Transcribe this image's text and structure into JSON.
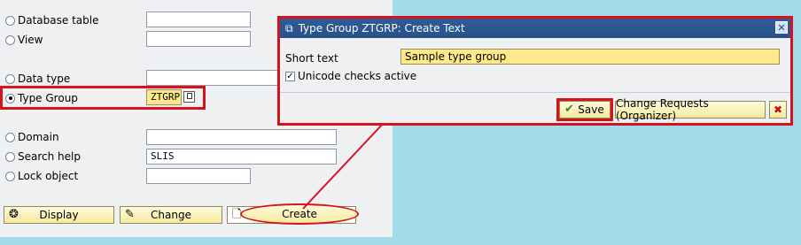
{
  "object_list": {
    "options": [
      {
        "label": "Database table",
        "value": "",
        "selected": false
      },
      {
        "label": "View",
        "value": "",
        "selected": false
      },
      {
        "label": "Data type",
        "value": "",
        "selected": false
      },
      {
        "label": "Type Group",
        "value": "ZTGRP",
        "selected": true
      },
      {
        "label": "Domain",
        "value": "",
        "selected": false
      },
      {
        "label": "Search help",
        "value": "SLIS",
        "selected": false
      },
      {
        "label": "Lock object",
        "value": "",
        "selected": false
      }
    ],
    "buttons": {
      "display": "Display",
      "change": "Change",
      "create": "Create"
    }
  },
  "dialog": {
    "title": "Type Group ZTGRP: Create Text",
    "short_text_label": "Short text",
    "short_text_value": "Sample type group",
    "unicode_label": "Unicode checks active",
    "unicode_checked": true,
    "save_label": "Save",
    "change_requests_label": "Change Requests (Organizer)",
    "close_icon": "close-icon",
    "cancel_icon": "cancel-icon"
  },
  "colors": {
    "highlight": "#d5121e",
    "background": "#a3dbe8",
    "title_bar": "#2e5b97",
    "yellow_field": "#ffe98a"
  }
}
